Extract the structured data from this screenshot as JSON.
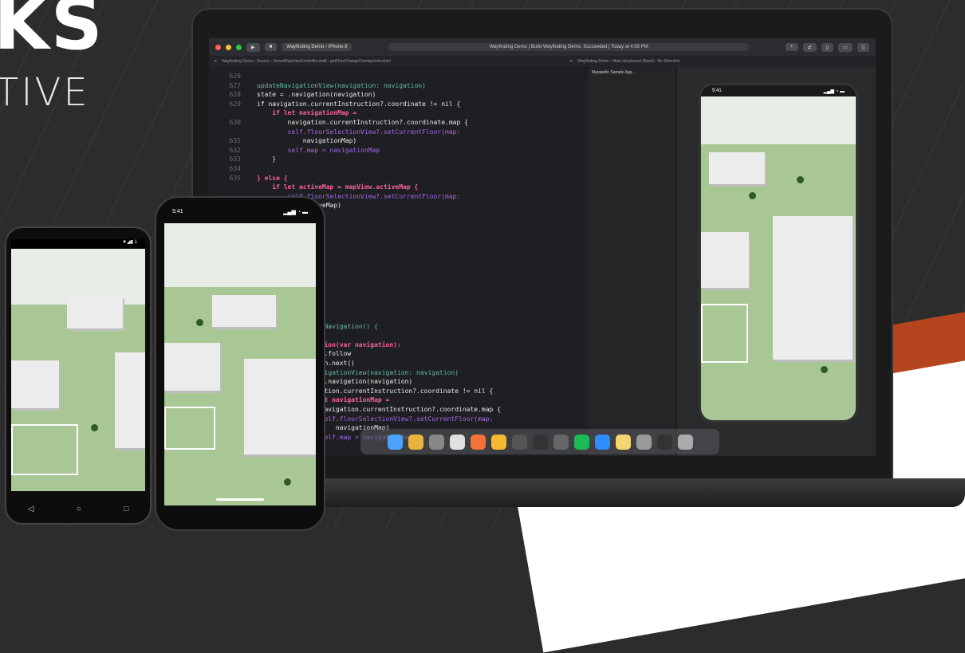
{
  "hero": {
    "title": "KS",
    "subtitle": "TIVE"
  },
  "xcode": {
    "scheme": "Wayfinding Demo",
    "device": "iPhone 8",
    "status": "Wayfinding Demo | Build Wayfinding Demo: Succeeded | Today at 4:55 PM",
    "path_left": "Wayfinding Demo › Source › VenueMapViewController.swift › getFloorChangeOverlayInstruction",
    "path_right": "Wayfinding Demo › Main.storyboard (Base) › No Selection",
    "navigator_item": "Mappedin Sample App...",
    "line_numbers": [
      "626",
      "627",
      "628",
      "629",
      "",
      "630",
      "",
      "631",
      "632",
      "633",
      "634",
      "635"
    ],
    "code_lines": [
      "updateNavigationView(navigation: navigation)",
      "state = .navigation(navigation)",
      "if navigation.currentInstruction?.coordinate != nil {",
      "    if let navigationMap =",
      "        navigation.currentInstruction?.coordinate.map {",
      "        self.floorSelectionView?.setCurrentFloor(map:",
      "            navigationMap)",
      "        self.map = navigationMap",
      "    }",
      "",
      "} else {",
      "    if let activeMap = mapView.activeMap {",
      "        self.floorSelectionView?.setCurrentFloor(map:",
      "            activeMap)"
    ],
    "code_lines_lower": [
      "extNavigation() {",
      "e {",
      "gation(var navigation):",
      " = .follow",
      "tion.next()",
      "NavigationView(navigation: navigation)",
      " = .navigation(navigation)",
      "igation.currentInstruction?.coordinate != nil {",
      " let navigationMap =",
      "  navigation.currentInstruction?.coordinate.map {",
      "  self.floorSelectionView?.setCurrentFloor(map:",
      "      navigationMap)",
      "  self.map = navigationMap"
    ]
  },
  "sim_status": {
    "time": "9:41",
    "icons": "▂▄▆ ◔ ▬"
  },
  "iphone_status": {
    "time": "9:41",
    "icons": "▂▄▆ ◔ ▬"
  },
  "android_status": {
    "icons": "▼◢▮ 1"
  },
  "android_nav": {
    "back": "◁",
    "home": "○",
    "recent": "□"
  },
  "colors": {
    "accent": "#b5451f",
    "map_green": "#a9c695",
    "building": "#ececec"
  },
  "dock_icons": [
    "finder-icon",
    "chrome-icon",
    "launchpad-icon",
    "slack-icon",
    "figma-icon",
    "sketch-icon",
    "screenshot-icon",
    "photo-icon",
    "settings-icon",
    "spotify-icon",
    "zoom-icon",
    "notes-icon",
    "help-icon",
    "terminal-icon",
    "trash-icon"
  ]
}
